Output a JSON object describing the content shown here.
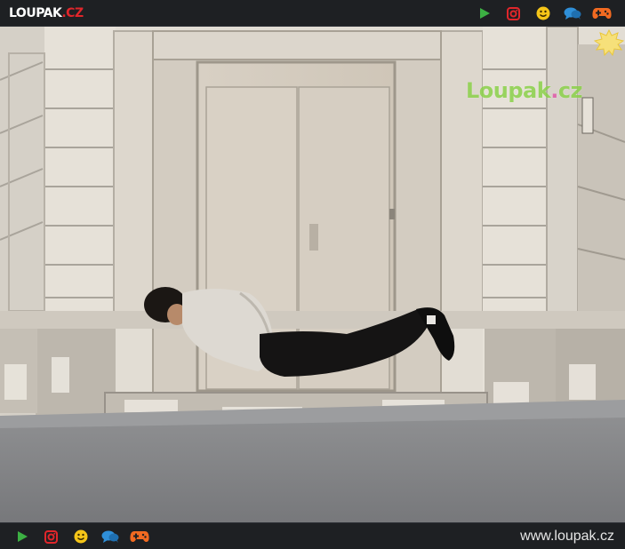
{
  "header": {
    "logo_main": "LOUPAK",
    "logo_tld": ".CZ",
    "icons": [
      "play-icon",
      "instagram-icon",
      "smiley-icon",
      "chat-icon",
      "gamepad-icon"
    ]
  },
  "photo": {
    "watermark_main": "Loupak",
    "watermark_dot": ".",
    "watermark_tld": "cz"
  },
  "footer": {
    "icons": [
      "play-icon",
      "instagram-icon",
      "smiley-icon",
      "chat-icon",
      "gamepad-icon"
    ],
    "site_url": "www.loupak.cz"
  },
  "colors": {
    "bar_bg": "#1e2023",
    "logo_red": "#e0262b",
    "play_green": "#3cb043",
    "instagram_red": "#e0262b",
    "smiley_yellow": "#f5c518",
    "chat_blue": "#2f8fd8",
    "gamepad_orange": "#f26a21",
    "watermark_green": "#8bd14a"
  }
}
